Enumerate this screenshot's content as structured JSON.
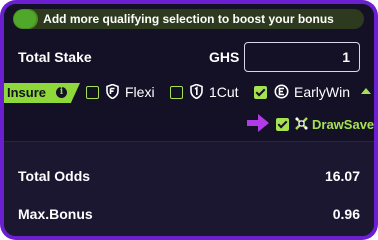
{
  "banner": {
    "text": "Add more qualifying selection to boost your bonus",
    "progress_fraction": 0.07,
    "fill_color": "#4e8c1f",
    "track_color": "#2d3a1e"
  },
  "stake": {
    "label": "Total Stake",
    "currency": "GHS",
    "value": "1"
  },
  "insure": {
    "label": "Insure",
    "info_icon": "info-icon",
    "tag_color": "#8fd83a",
    "options": [
      {
        "label": "Flexi",
        "checked": false,
        "icon": "flexi-shield-icon"
      },
      {
        "label": "1Cut",
        "checked": false,
        "icon": "onecut-shield-icon"
      },
      {
        "label": "EarlyWin",
        "checked": true,
        "icon": "earlywin-icon"
      }
    ],
    "collapse_icon": "chevron-up-icon"
  },
  "drawsave": {
    "label": "DrawSave",
    "checked": true,
    "icon": "drawsave-icon",
    "pointer_icon": "arrow-right-icon",
    "accent_color": "#a6e152"
  },
  "totals": {
    "odds_label": "Total Odds",
    "odds_value": "16.07",
    "bonus_label": "Max.Bonus",
    "bonus_value": "0.96"
  },
  "colors": {
    "frame": "#6b1fd0",
    "panel": "#141026",
    "accent": "#a6e152",
    "pointer": "#b23be8"
  }
}
